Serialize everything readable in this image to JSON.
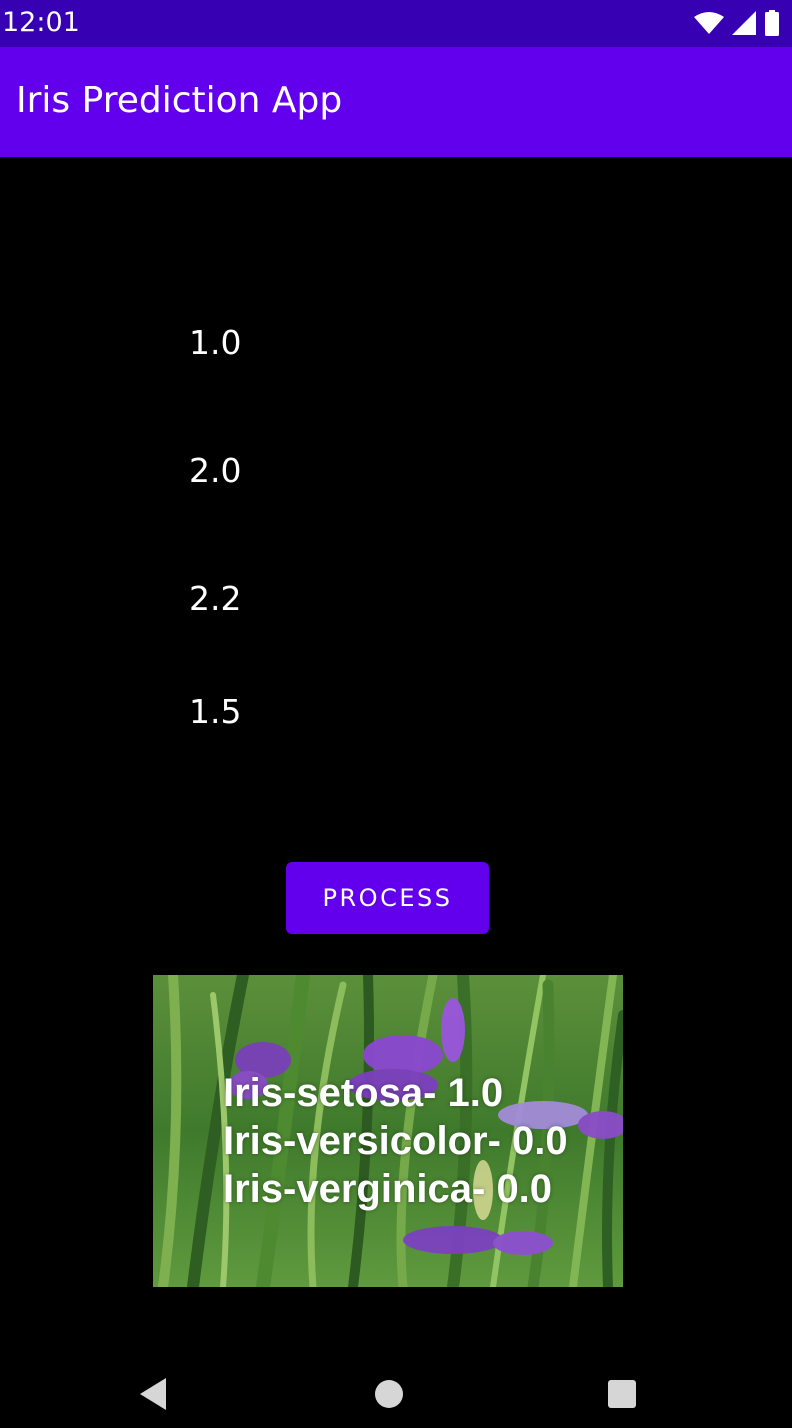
{
  "status_bar": {
    "time": "12:01",
    "icons": [
      "wifi-icon",
      "signal-icon",
      "battery-icon"
    ]
  },
  "app_bar": {
    "title": "Iris Prediction App"
  },
  "inputs": {
    "values": [
      "1.0",
      "2.0",
      "2.2",
      "1.5"
    ]
  },
  "process_button": {
    "label": "PROCESS"
  },
  "result": {
    "lines": [
      "Iris-setosa- 1.0",
      "Iris-versicolor- 0.0",
      "Iris-verginica- 0.0"
    ]
  },
  "nav_bar": {
    "icons": [
      "back-icon",
      "home-icon",
      "recents-icon"
    ]
  },
  "colors": {
    "status_bar": "#3700b3",
    "app_bar": "#6200ee",
    "button": "#6200ee",
    "background": "#000000",
    "text": "#ffffff"
  }
}
